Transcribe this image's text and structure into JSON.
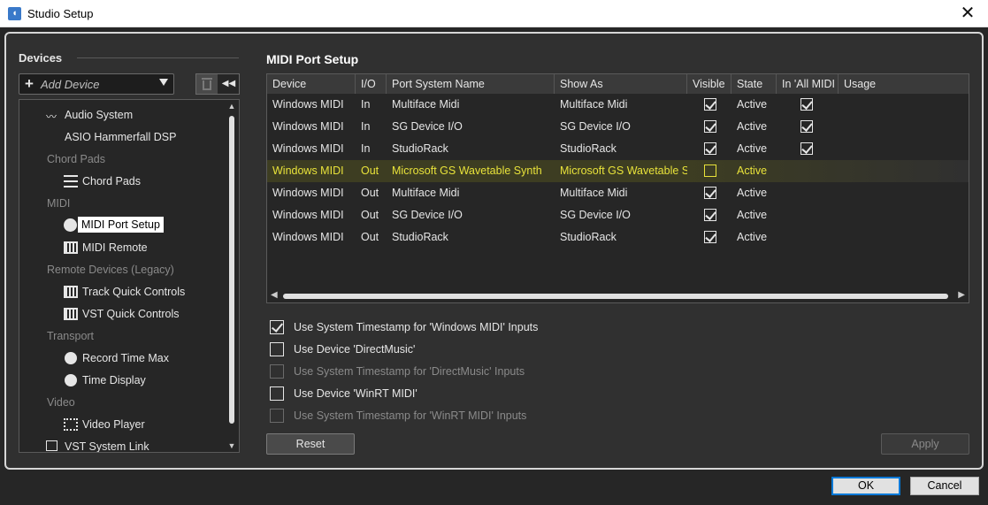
{
  "window": {
    "title": "Studio Setup",
    "close_glyph": "✕"
  },
  "devices": {
    "heading": "Devices",
    "add_device_label": "Add Device",
    "tree": [
      {
        "label": "Audio System",
        "icon": "audio-wave-icon",
        "type": "item"
      },
      {
        "label": "ASIO Hammerfall DSP",
        "icon": "",
        "type": "item"
      },
      {
        "label": "Chord Pads",
        "type": "category"
      },
      {
        "label": "Chord Pads",
        "icon": "sliders-icon",
        "type": "item"
      },
      {
        "label": "MIDI",
        "type": "category"
      },
      {
        "label": "MIDI Port Setup",
        "icon": "midi-connector-icon",
        "type": "item",
        "selected": true
      },
      {
        "label": "MIDI Remote",
        "icon": "keyboard-icon",
        "type": "item"
      },
      {
        "label": "Remote Devices (Legacy)",
        "type": "category"
      },
      {
        "label": "Track Quick Controls",
        "icon": "keyboard-icon",
        "type": "item"
      },
      {
        "label": "VST Quick Controls",
        "icon": "keyboard-icon",
        "type": "item"
      },
      {
        "label": "Transport",
        "type": "category"
      },
      {
        "label": "Record Time Max",
        "icon": "clock-icon",
        "type": "item"
      },
      {
        "label": "Time Display",
        "icon": "clock-icon",
        "type": "item"
      },
      {
        "label": "Video",
        "type": "category"
      },
      {
        "label": "Video Player",
        "icon": "video-frame-icon",
        "type": "item"
      },
      {
        "label": "VST System Link",
        "icon": "link-icon",
        "type": "item"
      }
    ]
  },
  "midi_port_setup": {
    "title": "MIDI Port Setup",
    "columns": [
      "Device",
      "I/O",
      "Port System Name",
      "Show As",
      "Visible",
      "State",
      "In 'All MIDI Inputs'",
      "Usage"
    ],
    "rows": [
      {
        "device": "Windows MIDI",
        "io": "In",
        "port": "Multiface Midi",
        "show_as": "Multiface Midi",
        "visible": true,
        "state": "Active",
        "all_midi": true
      },
      {
        "device": "Windows MIDI",
        "io": "In",
        "port": "SG Device I/O",
        "show_as": "SG Device I/O",
        "visible": true,
        "state": "Active",
        "all_midi": true
      },
      {
        "device": "Windows MIDI",
        "io": "In",
        "port": "StudioRack",
        "show_as": "StudioRack",
        "visible": true,
        "state": "Active",
        "all_midi": true
      },
      {
        "device": "Windows MIDI",
        "io": "Out",
        "port": "Microsoft GS Wavetable Synth",
        "show_as": "Microsoft GS Wavetable Synth",
        "visible": false,
        "state": "Active",
        "all_midi": null,
        "highlighted": true
      },
      {
        "device": "Windows MIDI",
        "io": "Out",
        "port": "Multiface Midi",
        "show_as": "Multiface Midi",
        "visible": true,
        "state": "Active",
        "all_midi": null
      },
      {
        "device": "Windows MIDI",
        "io": "Out",
        "port": "SG Device I/O",
        "show_as": "SG Device I/O",
        "visible": true,
        "state": "Active",
        "all_midi": null
      },
      {
        "device": "Windows MIDI",
        "io": "Out",
        "port": "StudioRack",
        "show_as": "StudioRack",
        "visible": true,
        "state": "Active",
        "all_midi": null
      }
    ],
    "options": [
      {
        "label": "Use System Timestamp for 'Windows MIDI' Inputs",
        "checked": true,
        "enabled": true
      },
      {
        "label": "Use Device 'DirectMusic'",
        "checked": false,
        "enabled": true
      },
      {
        "label": "Use System Timestamp for 'DirectMusic' Inputs",
        "checked": false,
        "enabled": false
      },
      {
        "label": "Use Device 'WinRT MIDI'",
        "checked": false,
        "enabled": true
      },
      {
        "label": "Use System Timestamp for 'WinRT MIDI' Inputs",
        "checked": false,
        "enabled": false
      }
    ],
    "reset_label": "Reset",
    "apply_label": "Apply"
  },
  "footer": {
    "ok_label": "OK",
    "cancel_label": "Cancel"
  },
  "colors": {
    "highlight_text": "#e8e23a",
    "panel_bg": "#303030",
    "accent_border": "#0078d7"
  }
}
